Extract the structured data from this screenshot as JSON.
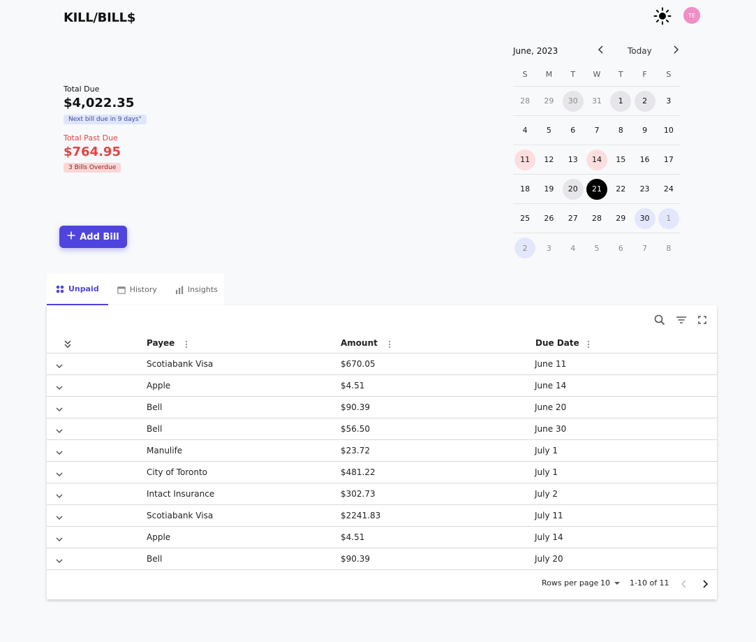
{
  "brand": "KILL/BILL$",
  "avatar_initials": "TE",
  "summary": {
    "total_due_label": "Total Due",
    "total_due_value": "$4,022.35",
    "next_bill_badge": "Next bill due in 9 days\"",
    "past_due_label": "Total Past Due",
    "past_due_value": "$764.95",
    "overdue_badge": "3 Bills Overdue"
  },
  "add_bill_label": "Add Bill",
  "calendar": {
    "month": "June, 2023",
    "today_label": "Today",
    "dow": [
      "S",
      "M",
      "T",
      "W",
      "T",
      "F",
      "S"
    ],
    "weeks": [
      [
        {
          "d": "28",
          "s": "muted"
        },
        {
          "d": "29",
          "s": "muted"
        },
        {
          "d": "30",
          "s": "muted gray"
        },
        {
          "d": "31",
          "s": "muted"
        },
        {
          "d": "1",
          "s": "gray"
        },
        {
          "d": "2",
          "s": "gray"
        },
        {
          "d": "3",
          "s": ""
        }
      ],
      [
        {
          "d": "4",
          "s": ""
        },
        {
          "d": "5",
          "s": ""
        },
        {
          "d": "6",
          "s": ""
        },
        {
          "d": "7",
          "s": ""
        },
        {
          "d": "8",
          "s": ""
        },
        {
          "d": "9",
          "s": ""
        },
        {
          "d": "10",
          "s": ""
        }
      ],
      [
        {
          "d": "11",
          "s": "red"
        },
        {
          "d": "12",
          "s": ""
        },
        {
          "d": "13",
          "s": ""
        },
        {
          "d": "14",
          "s": "red"
        },
        {
          "d": "15",
          "s": ""
        },
        {
          "d": "16",
          "s": ""
        },
        {
          "d": "17",
          "s": ""
        }
      ],
      [
        {
          "d": "18",
          "s": ""
        },
        {
          "d": "19",
          "s": ""
        },
        {
          "d": "20",
          "s": "gray"
        },
        {
          "d": "21",
          "s": "today"
        },
        {
          "d": "22",
          "s": ""
        },
        {
          "d": "23",
          "s": ""
        },
        {
          "d": "24",
          "s": ""
        }
      ],
      [
        {
          "d": "25",
          "s": ""
        },
        {
          "d": "26",
          "s": ""
        },
        {
          "d": "27",
          "s": ""
        },
        {
          "d": "28",
          "s": ""
        },
        {
          "d": "29",
          "s": ""
        },
        {
          "d": "30",
          "s": "blue"
        },
        {
          "d": "1",
          "s": "muted blue"
        }
      ],
      [
        {
          "d": "2",
          "s": "muted blue"
        },
        {
          "d": "3",
          "s": "muted"
        },
        {
          "d": "4",
          "s": "muted"
        },
        {
          "d": "5",
          "s": "muted"
        },
        {
          "d": "6",
          "s": "muted"
        },
        {
          "d": "7",
          "s": "muted"
        },
        {
          "d": "8",
          "s": "muted"
        }
      ]
    ]
  },
  "tabs": [
    {
      "label": "Unpaid",
      "icon": "grid-icon",
      "active": true
    },
    {
      "label": "History",
      "icon": "calendar-icon",
      "active": false
    },
    {
      "label": "Insights",
      "icon": "bar-chart-icon",
      "active": false
    }
  ],
  "table": {
    "columns": {
      "payee": "Payee",
      "amount": "Amount",
      "due_date": "Due Date"
    },
    "rows": [
      {
        "payee": "Scotiabank Visa",
        "amount": "$670.05",
        "due": "June 11"
      },
      {
        "payee": "Apple",
        "amount": "$4.51",
        "due": "June 14"
      },
      {
        "payee": "Bell",
        "amount": "$90.39",
        "due": "June 20"
      },
      {
        "payee": "Bell",
        "amount": "$56.50",
        "due": "June 30"
      },
      {
        "payee": "Manulife",
        "amount": "$23.72",
        "due": "July 1"
      },
      {
        "payee": "City of Toronto",
        "amount": "$481.22",
        "due": "July 1"
      },
      {
        "payee": "Intact Insurance",
        "amount": "$302.73",
        "due": "July 2"
      },
      {
        "payee": "Scotiabank Visa",
        "amount": "$2241.83",
        "due": "July 11"
      },
      {
        "payee": "Apple",
        "amount": "$4.51",
        "due": "July 14"
      },
      {
        "payee": "Bell",
        "amount": "$90.39",
        "due": "July 20"
      }
    ],
    "pagination": {
      "rows_per_page_label": "Rows per page",
      "rows_per_page_value": "10",
      "range": "1-10 of 11"
    }
  },
  "colors": {
    "accent": "#4f44e0",
    "danger": "#e04444",
    "today": "#000000"
  }
}
